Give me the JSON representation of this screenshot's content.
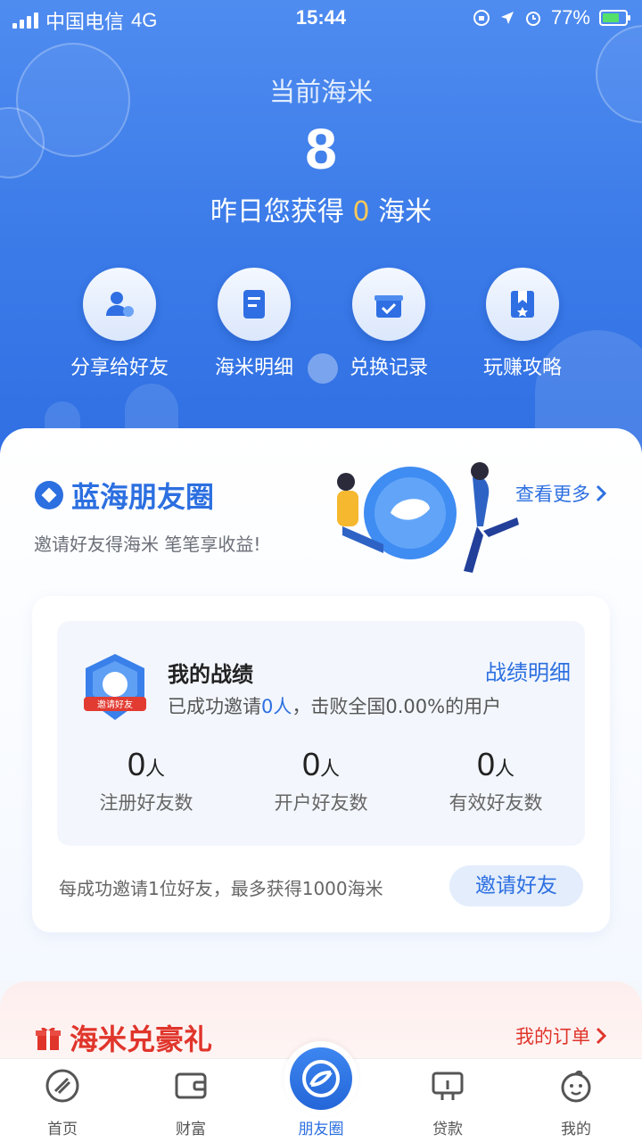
{
  "status_bar": {
    "carrier": "中国电信",
    "network": "4G",
    "time": "15:44",
    "battery": "77%",
    "battery_level": 0.77
  },
  "header": {
    "title": "当前海米",
    "amount": "8",
    "yesterday_prefix": "昨日您获得",
    "yesterday_value": "0",
    "yesterday_suffix": "海米"
  },
  "quick_actions": [
    {
      "label": "分享给好友",
      "icon": "share-friend-icon"
    },
    {
      "label": "海米明细",
      "icon": "receipt-icon"
    },
    {
      "label": "兑换记录",
      "icon": "gift-box-icon"
    },
    {
      "label": "玩赚攻略",
      "icon": "bookmark-book-icon"
    }
  ],
  "friend_circle": {
    "title": "蓝海朋友圈",
    "subtitle": "邀请好友得海米 笔笔享收益!",
    "more_label": "查看更多",
    "stats": {
      "title": "我的战绩",
      "detail_link": "战绩明细",
      "desc_prefix": "已成功邀请",
      "desc_count": "0人",
      "desc_suffix": "，击败全国0.00%的用户",
      "badge_text": "邀请好友",
      "metrics": [
        {
          "value": "0",
          "unit": "人",
          "label": "注册好友数"
        },
        {
          "value": "0",
          "unit": "人",
          "label": "开户好友数"
        },
        {
          "value": "0",
          "unit": "人",
          "label": "有效好友数"
        }
      ]
    },
    "invite_tip": "每成功邀请1位好友，最多获得1000海米",
    "invite_button": "邀请好友"
  },
  "gift_section": {
    "title": "海米兑豪礼",
    "orders_label": "我的订单"
  },
  "tabbar": {
    "items": [
      {
        "label": "首页",
        "icon": "home-logo-icon"
      },
      {
        "label": "财富",
        "icon": "wallet-icon"
      },
      {
        "label": "朋友圈",
        "icon": "friend-circle-icon"
      },
      {
        "label": "贷款",
        "icon": "loan-icon"
      },
      {
        "label": "我的",
        "icon": "profile-face-icon"
      }
    ],
    "active_index": 2
  },
  "colors": {
    "primary": "#2c6fe0",
    "header_bg": "#3a7ae8",
    "accent_gold": "#f7c95a",
    "gift_red": "#e0352b"
  }
}
